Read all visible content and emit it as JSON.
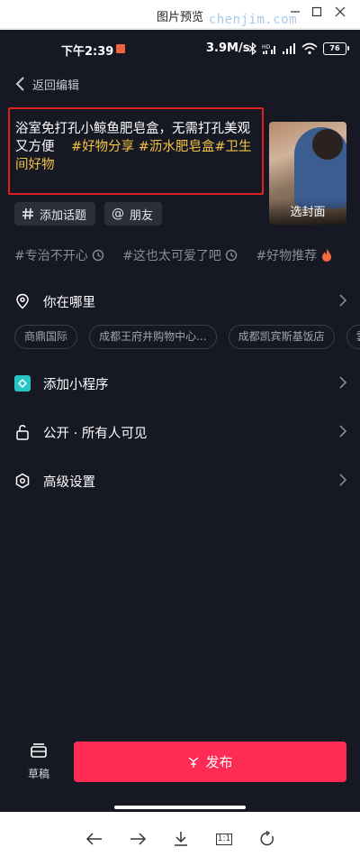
{
  "window": {
    "title": "图片预览",
    "watermark": "chenjim.com"
  },
  "status_bar": {
    "time": "下午2:39",
    "net_speed": "3.9M/s",
    "battery": "76"
  },
  "header": {
    "back_label": "返回编辑"
  },
  "caption": {
    "text": "浴室免打孔小鲸鱼肥皂盒，无需打孔美观又方便",
    "hashtags": "#好物分享 #沥水肥皂盒#卫生间好物"
  },
  "cover": {
    "label": "选封面"
  },
  "chips": {
    "topic": "添加话题",
    "friend": "朋友"
  },
  "suggested_tags": [
    "#专治不开心",
    "#这也太可爱了吧",
    "#好物推荐"
  ],
  "location": {
    "label": "你在哪里",
    "options": [
      "商鼎国际",
      "成都王府井购物中心...",
      "成都凯宾斯基饭店",
      "雲"
    ]
  },
  "mini_program": {
    "label": "添加小程序"
  },
  "visibility": {
    "label": "公开 · 所有人可见"
  },
  "advanced": {
    "label": "高级设置"
  },
  "actions": {
    "draft": "草稿",
    "publish": "发布"
  },
  "viewer_toolbar": {
    "actual_size": "1:1"
  },
  "colors": {
    "background": "#161823",
    "publish": "#fe2c55",
    "hashtag": "#f5c343",
    "highlight_box": "#e02020",
    "mini_program_icon": "#27c4c5"
  }
}
